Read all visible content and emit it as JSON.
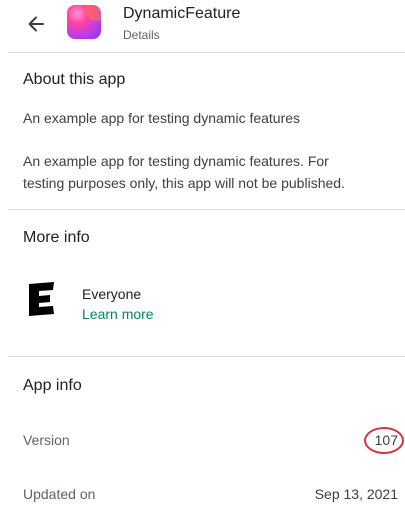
{
  "header": {
    "title": "DynamicFeature",
    "subtitle": "Details",
    "back_icon": "arrow-left-icon",
    "app_icon": "app-icon"
  },
  "about": {
    "title": "About this app",
    "short_description": "An example app for testing dynamic features",
    "full_description": "An example app for testing dynamic features. For testing purposes only, this app will not be published."
  },
  "more_info": {
    "title": "More info",
    "rating_icon": "esrb-everyone-icon",
    "rating": "Everyone",
    "learn_more": "Learn more",
    "learn_more_color": "#01875f"
  },
  "app_info": {
    "title": "App info",
    "version_label": "Version",
    "version_value": "107",
    "updated_label": "Updated on",
    "updated_value": "Sep 13, 2021"
  },
  "annotation": {
    "highlight_color": "#d8323c"
  }
}
